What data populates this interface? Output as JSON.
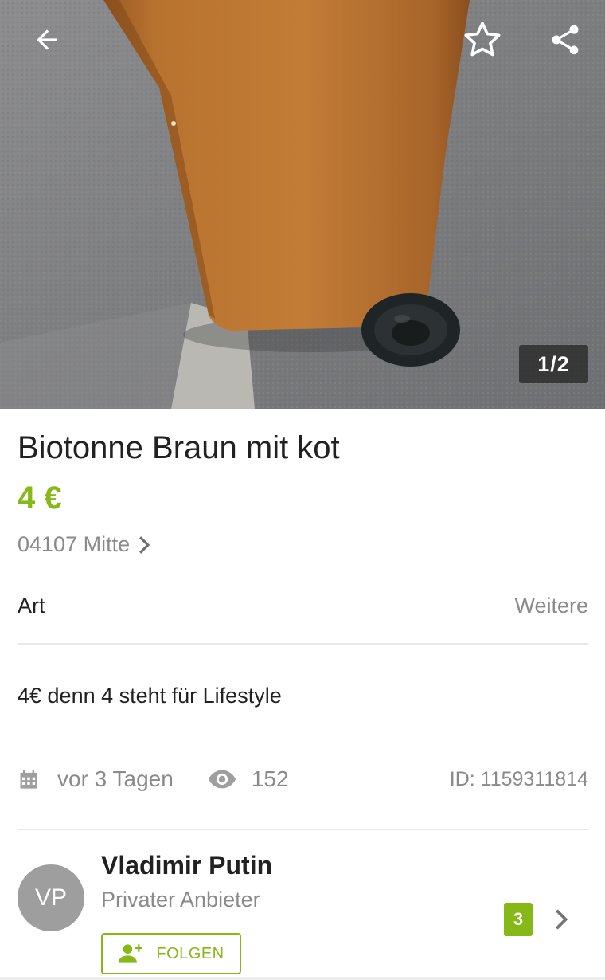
{
  "gallery": {
    "counter": "1/2"
  },
  "listing": {
    "title": "Biotonne Braun mit kot",
    "price": "4 €",
    "location": "04107 Mitte",
    "attribute": {
      "key": "Art",
      "value": "Weitere"
    },
    "description": "4€ denn 4 steht für Lifestyle",
    "posted": "vor 3 Tagen",
    "views": "152",
    "id": "ID: 1159311814"
  },
  "seller": {
    "initials": "VP",
    "name": "Vladimir Putin",
    "type": "Privater Anbieter",
    "follow_label": "FOLGEN",
    "badge_count": "3"
  },
  "icons": {
    "back": "arrow-left-icon",
    "favorite": "star-outline-icon",
    "share": "share-icon",
    "location_chevron": "chevron-right-icon",
    "calendar": "calendar-icon",
    "views": "eye-icon",
    "follow": "person-add-icon",
    "seller_chevron": "chevron-right-icon"
  },
  "colors": {
    "accent": "#86b817",
    "text": "#212121",
    "muted": "#8a8a8a",
    "avatar": "#9e9e9e"
  }
}
